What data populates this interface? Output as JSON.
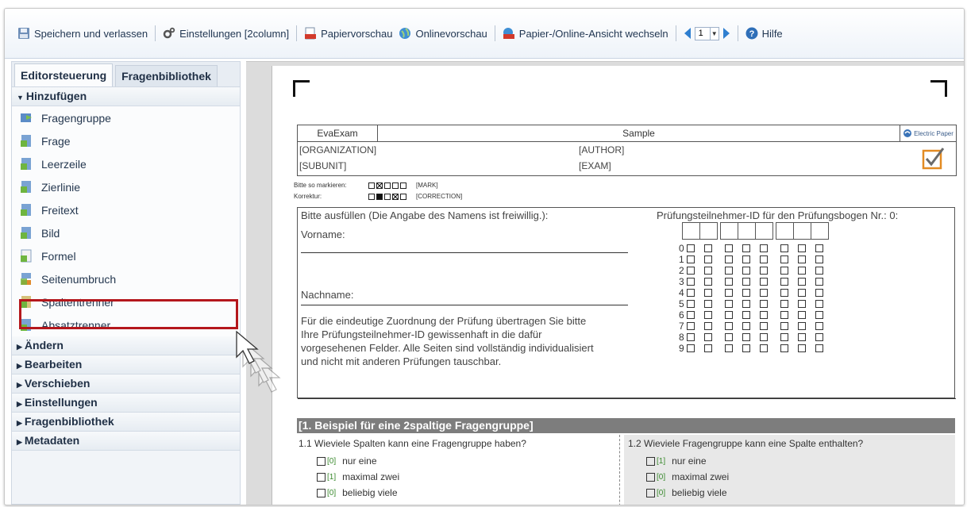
{
  "toolbar": {
    "save": "Speichern und verlassen",
    "settings": "Einstellungen [2column]",
    "paper_preview": "Papiervorschau",
    "online_preview": "Onlinevorschau",
    "switch_view": "Papier-/Online-Ansicht wechseln",
    "page_value": "1",
    "help": "Hilfe"
  },
  "sidebar": {
    "tabs": [
      "Editorsteuerung",
      "Fragenbibliothek"
    ],
    "open_section": "Hinzufügen",
    "items": [
      "Fragengruppe",
      "Frage",
      "Leerzeile",
      "Zierlinie",
      "Freitext",
      "Bild",
      "Formel",
      "Seitenumbruch",
      "Spaltentrenner",
      "Absatztrenner"
    ],
    "sections": [
      "Ändern",
      "Bearbeiten",
      "Verschieben",
      "Einstellungen",
      "Fragenbibliothek",
      "Metadaten"
    ]
  },
  "document": {
    "eva": "EvaExam",
    "sample": "Sample",
    "logo_text": "Electric Paper",
    "organization": "[ORGANIZATION]",
    "author": "[AUTHOR]",
    "subunit": "[SUBUNIT]",
    "exam": "[EXAM]",
    "mark_label": "Bitte so markieren:",
    "mark_tag": "[MARK]",
    "correction_label": "Korrektur:",
    "correction_tag": "[CORRECTION]",
    "fill_in": "Bitte ausfüllen (Die Angabe des Namens ist freiwillig.):",
    "firstname": "Vorname:",
    "lastname": "Nachname:",
    "id_title": "Prüfungsteilnehmer-ID für den Prüfungsbogen Nr.: 0:",
    "instruction_lines": [
      "Für die eindeutige Zuordnung der Prüfung übertragen Sie bitte",
      "Ihre Prüfungsteilnehmer-ID gewissenhaft in die dafür",
      "vorgesehenen Felder. Alle Seiten sind vollständig individualisiert",
      "und nicht mit anderen Prüfungen tauschbar."
    ],
    "digits": [
      "0",
      "1",
      "2",
      "3",
      "4",
      "5",
      "6",
      "7",
      "8",
      "9"
    ],
    "group_title": "[1. Beispiel für eine 2spaltige Fragengruppe]",
    "q1": {
      "number": "1.1",
      "text": "Wieviele Spalten kann eine Fragengruppe haben?",
      "options": [
        {
          "code": "[0]",
          "label": "nur eine"
        },
        {
          "code": "[1]",
          "label": "maximal zwei"
        },
        {
          "code": "[0]",
          "label": "beliebig viele"
        }
      ]
    },
    "q2": {
      "number": "1.2",
      "text": "Wieviele Fragengruppe kann eine Spalte enthalten?",
      "options": [
        {
          "code": "[1]",
          "label": "nur eine"
        },
        {
          "code": "[0]",
          "label": "maximal zwei"
        },
        {
          "code": "[0]",
          "label": "beliebig viele"
        }
      ]
    }
  }
}
